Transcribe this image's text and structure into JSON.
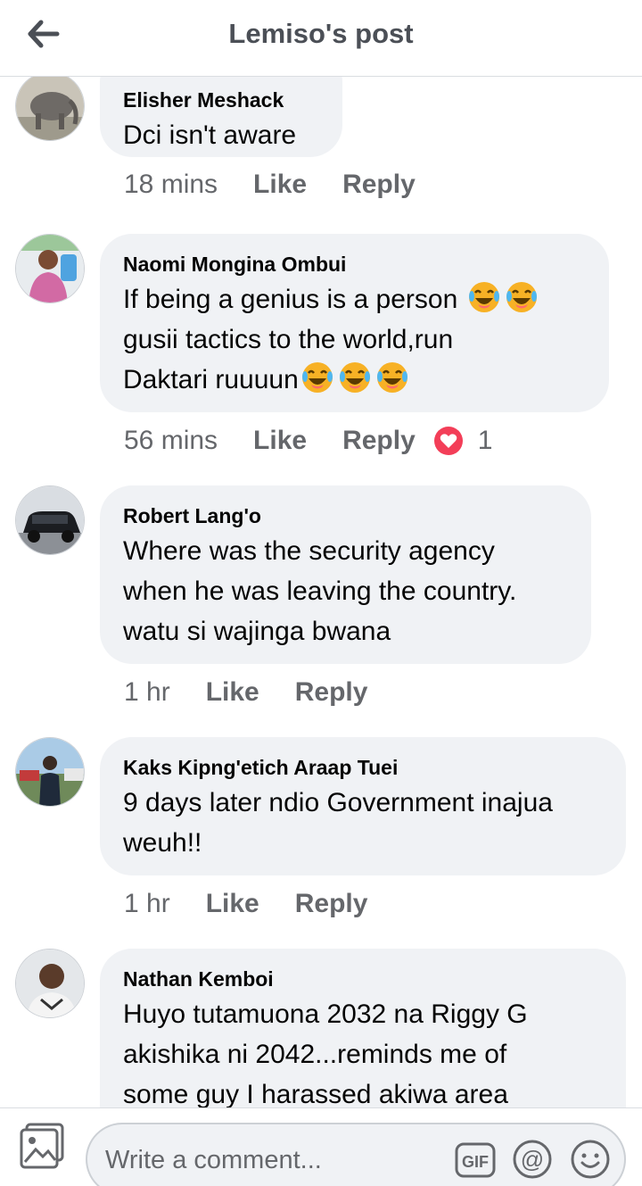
{
  "header": {
    "title": "Lemiso's post",
    "back_icon": "arrow-left-icon"
  },
  "comments": [
    {
      "author": "Elisher Meshack",
      "lines": [
        "Dci isn't aware"
      ],
      "time": "18 mins",
      "like": "Like",
      "reply": "Reply",
      "avatar": "elephant-photo"
    },
    {
      "author": "Naomi Mongina Ombui",
      "lines": [
        "If being a genius is a person",
        "gusii tactics to the world,run",
        "Daktari ruuuun"
      ],
      "time": "56 mins",
      "like": "Like",
      "reply": "Reply",
      "reaction_count": "1",
      "reaction": "love-icon",
      "avatar": "woman-photo"
    },
    {
      "author": "Robert Lang'o",
      "lines": [
        "Where was the security agency",
        "when he was leaving the country.",
        "watu si wajinga bwana"
      ],
      "time": "1 hr",
      "like": "Like",
      "reply": "Reply",
      "avatar": "car-photo"
    },
    {
      "author": "Kaks Kipng'etich Araap Tuei",
      "lines": [
        "9 days later ndio Government inajua",
        "weuh!!"
      ],
      "time": "1 hr",
      "like": "Like",
      "reply": "Reply",
      "avatar": "man-outdoors-photo"
    },
    {
      "author": "Nathan Kemboi",
      "lines": [
        "Huyo tutamuona 2032 na Riggy G",
        "akishika ni 2042...reminds me of",
        "some guy I harassed akiwa area"
      ],
      "avatar": "man-portrait-photo"
    }
  ],
  "composer": {
    "placeholder": "Write a comment...",
    "gif_label": "GIF",
    "mention_label": "@"
  },
  "colors": {
    "bubble": "#f0f2f5",
    "meta": "#65676b",
    "love": "#f33e58",
    "laugh": "#f7b125"
  }
}
